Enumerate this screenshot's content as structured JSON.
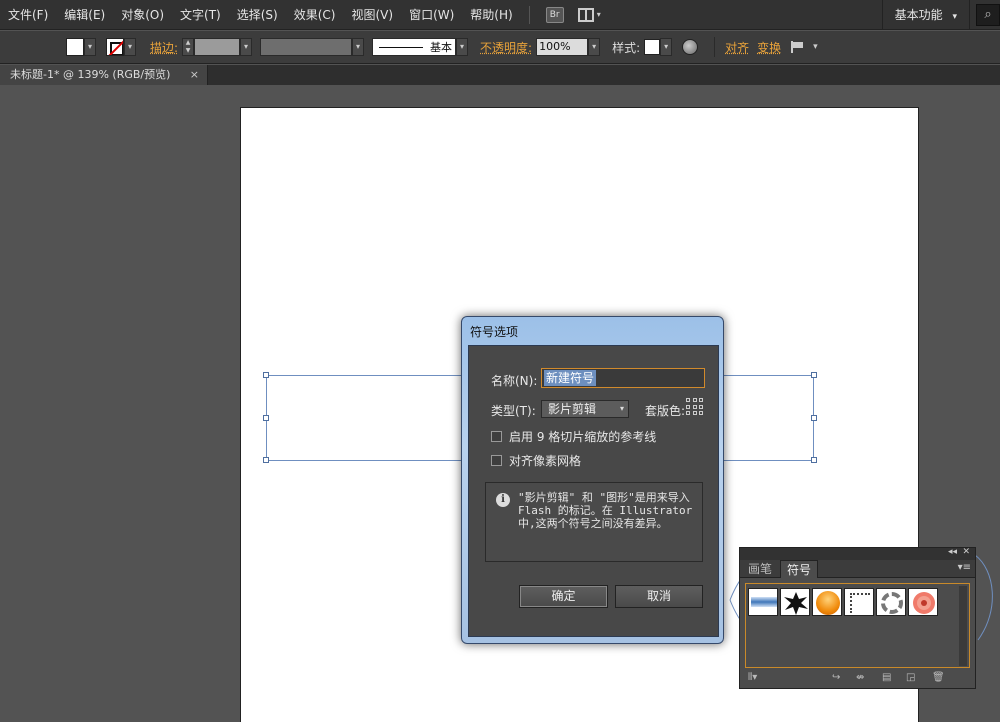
{
  "menubar": {
    "items": [
      "文件(F)",
      "编辑(E)",
      "对象(O)",
      "文字(T)",
      "选择(S)",
      "效果(C)",
      "视图(V)",
      "窗口(W)",
      "帮助(H)"
    ],
    "bridge_label": "Br",
    "workspace": "基本功能",
    "workspace_caret": "▾"
  },
  "controlbar": {
    "stroke_label": "描边:",
    "stroke_profile": "基本",
    "opacity_label": "不透明度:",
    "opacity_value": "100%",
    "style_label": "样式:",
    "align_label": "对齐",
    "transform_label": "变换",
    "caret": "▾"
  },
  "tab": {
    "title": "未标题-1* @ 139% (RGB/预览)",
    "close": "×"
  },
  "dialog": {
    "title": "符号选项",
    "name_label": "名称(N):",
    "name_value": "新建符号",
    "type_label": "类型(T):",
    "type_value": "影片剪辑",
    "registration_label": "套版色:",
    "nine_slice_label": "启用 9 格切片缩放的参考线",
    "pixel_grid_label": "对齐像素网格",
    "info_icon": "i",
    "info_text": "\"影片剪辑\" 和 \"图形\"是用来导入 Flash 的标记。在 Illustrator 中,这两个符号之间没有差异。",
    "ok_label": "确定",
    "cancel_label": "取消"
  },
  "symbols_panel": {
    "tabs": [
      "画笔",
      "符号"
    ],
    "collapse": "◂◂",
    "close": "✕",
    "menu": "▾≡",
    "thumbnails": [
      "blue-gradient-bar",
      "ink-splat",
      "orange-button",
      "dotted-corner",
      "chain-ring",
      "red-flower"
    ]
  },
  "colors": {
    "menubar_bg": "#323232",
    "control_bg": "#3c3c3c",
    "canvas_bg": "#535353",
    "accent_orange": "#e8a23a",
    "selection_blue": "#6f8fc0"
  }
}
